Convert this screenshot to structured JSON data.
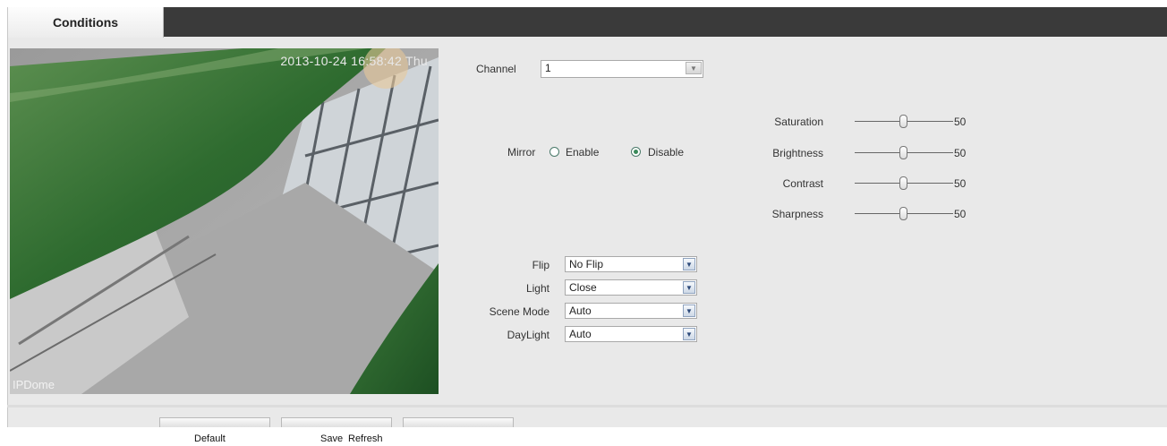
{
  "tab": {
    "label": "Conditions"
  },
  "preview": {
    "timestamp": "2013-10-24 16:58:42 Thu",
    "channel_name": "IPDome"
  },
  "channel": {
    "label": "Channel",
    "value": "1"
  },
  "mirror": {
    "label": "Mirror",
    "options": [
      {
        "label": "Enable",
        "checked": false
      },
      {
        "label": "Disable",
        "checked": true
      }
    ]
  },
  "selects": [
    {
      "label": "Flip",
      "value": "No Flip"
    },
    {
      "label": "Light",
      "value": "Close"
    },
    {
      "label": "Scene Mode",
      "value": "Auto"
    },
    {
      "label": "DayLight",
      "value": "Auto"
    }
  ],
  "sliders": [
    {
      "label": "Saturation",
      "value": 50,
      "min": 0,
      "max": 100
    },
    {
      "label": "Brightness",
      "value": 50,
      "min": 0,
      "max": 100
    },
    {
      "label": "Contrast",
      "value": 50,
      "min": 0,
      "max": 100
    },
    {
      "label": "Sharpness",
      "value": 50,
      "min": 0,
      "max": 100
    }
  ],
  "buttons": {
    "default": "Default",
    "save": "Save",
    "refresh": "Refresh"
  },
  "colors": {
    "tabbar": "#3a3a3a",
    "panel": "#e9e9e9",
    "leaf_green": "#3f7a3a"
  }
}
